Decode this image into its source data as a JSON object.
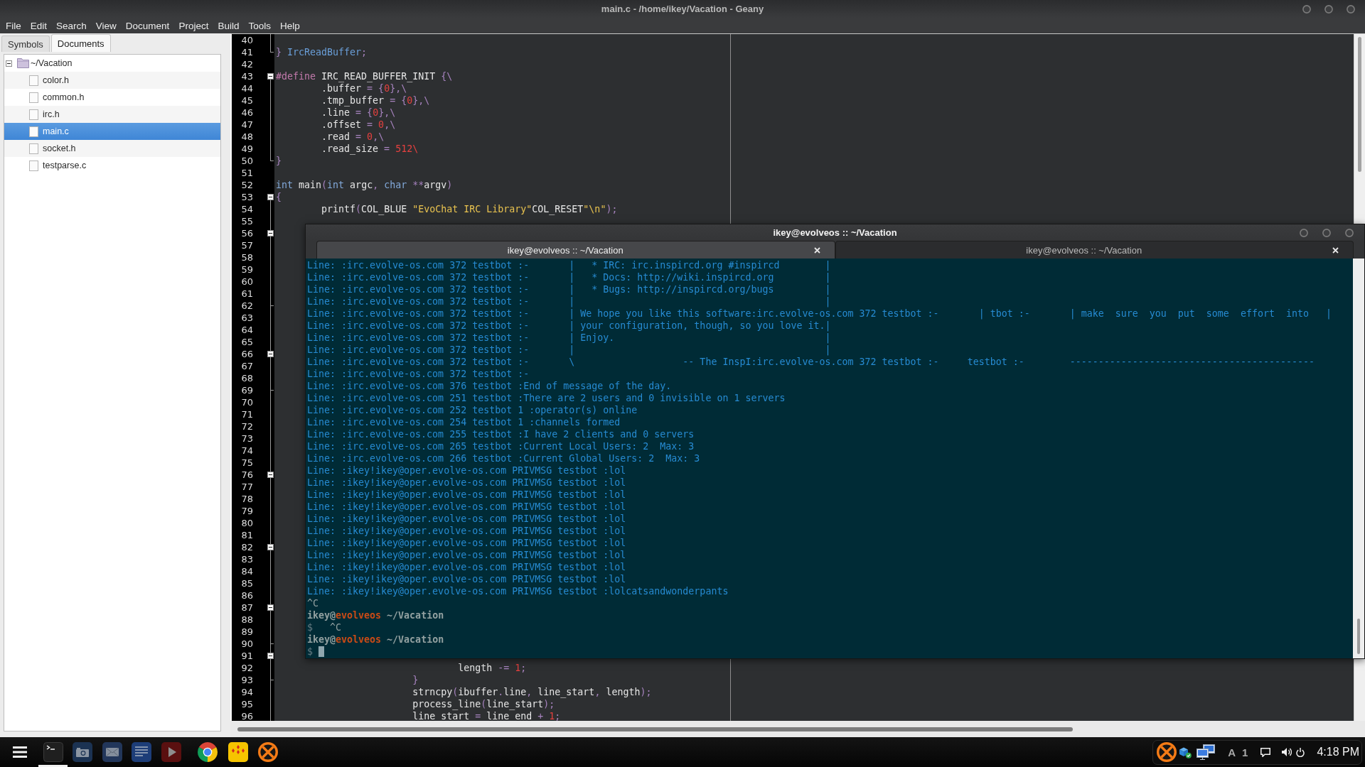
{
  "window": {
    "title": "main.c - /home/ikey/Vacation - Geany"
  },
  "menu": [
    "File",
    "Edit",
    "Search",
    "View",
    "Document",
    "Project",
    "Build",
    "Tools",
    "Help"
  ],
  "sidebar": {
    "tabs": [
      {
        "label": "Symbols",
        "selected": false
      },
      {
        "label": "Documents",
        "selected": true
      }
    ],
    "tree": [
      {
        "label": "~/Vacation",
        "expanded": true,
        "selected": false,
        "children": [
          {
            "label": "color.h",
            "selected": false
          },
          {
            "label": "common.h",
            "selected": false
          },
          {
            "label": "irc.h",
            "selected": false
          },
          {
            "label": "main.c",
            "selected": true
          },
          {
            "label": "socket.h",
            "selected": false
          },
          {
            "label": "testparse.c",
            "selected": false
          }
        ]
      }
    ]
  },
  "editor": {
    "lines": [
      {
        "number": "40",
        "kind": "body"
      },
      {
        "number": "41",
        "kind": "end",
        "tokens": [
          {
            "text": "} ",
            "kind": "operator"
          },
          {
            "text": "IrcReadBuffer",
            "kind": "type"
          },
          {
            "text": ";",
            "kind": "operator"
          }
        ]
      },
      {
        "number": "42",
        "kind": "plain"
      },
      {
        "number": "43",
        "kind": "start",
        "tokens": [
          {
            "text": "#define",
            "kind": "preprocessor"
          },
          {
            "text": " IRC_READ_BUFFER_INIT ",
            "kind": "plain"
          },
          {
            "text": "{\\",
            "kind": "operator"
          }
        ]
      },
      {
        "number": "44",
        "kind": "body",
        "tokens": [
          {
            "text": "        .buffer ",
            "kind": "plain"
          },
          {
            "text": "= {",
            "kind": "operator"
          },
          {
            "text": "0",
            "kind": "number"
          },
          {
            "text": "},\\",
            "kind": "operator"
          }
        ]
      },
      {
        "number": "45",
        "kind": "body",
        "tokens": [
          {
            "text": "        .tmp_buffer ",
            "kind": "plain"
          },
          {
            "text": "= {",
            "kind": "operator"
          },
          {
            "text": "0",
            "kind": "number"
          },
          {
            "text": "},\\",
            "kind": "operator"
          }
        ]
      },
      {
        "number": "46",
        "kind": "body",
        "tokens": [
          {
            "text": "        .line ",
            "kind": "plain"
          },
          {
            "text": "= {",
            "kind": "operator"
          },
          {
            "text": "0",
            "kind": "number"
          },
          {
            "text": "},\\",
            "kind": "operator"
          }
        ]
      },
      {
        "number": "47",
        "kind": "body",
        "tokens": [
          {
            "text": "        .offset ",
            "kind": "plain"
          },
          {
            "text": "= ",
            "kind": "operator"
          },
          {
            "text": "0",
            "kind": "number"
          },
          {
            "text": ",\\",
            "kind": "operator"
          }
        ]
      },
      {
        "number": "48",
        "kind": "body",
        "tokens": [
          {
            "text": "        .read ",
            "kind": "plain"
          },
          {
            "text": "= ",
            "kind": "operator"
          },
          {
            "text": "0",
            "kind": "number"
          },
          {
            "text": ",\\",
            "kind": "operator"
          }
        ]
      },
      {
        "number": "49",
        "kind": "body",
        "tokens": [
          {
            "text": "        .read_size ",
            "kind": "plain"
          },
          {
            "text": "= ",
            "kind": "operator"
          },
          {
            "text": "512\\",
            "kind": "number"
          }
        ]
      },
      {
        "number": "50",
        "kind": "end",
        "tokens": [
          {
            "text": "}",
            "kind": "operator"
          }
        ]
      },
      {
        "number": "51",
        "kind": "plain"
      },
      {
        "number": "52",
        "kind": "plain",
        "tokens": [
          {
            "text": "int",
            "kind": "keyword"
          },
          {
            "text": " main",
            "kind": "plain"
          },
          {
            "text": "(",
            "kind": "operator"
          },
          {
            "text": "int",
            "kind": "keyword"
          },
          {
            "text": " argc",
            "kind": "plain"
          },
          {
            "text": ", ",
            "kind": "operator"
          },
          {
            "text": "char",
            "kind": "keyword"
          },
          {
            "text": " **",
            "kind": "operator"
          },
          {
            "text": "argv",
            "kind": "plain"
          },
          {
            "text": ")",
            "kind": "operator"
          }
        ]
      },
      {
        "number": "53",
        "kind": "start",
        "tokens": [
          {
            "text": "{",
            "kind": "operator"
          }
        ]
      },
      {
        "number": "54",
        "kind": "body",
        "tokens": [
          {
            "text": "        printf",
            "kind": "plain"
          },
          {
            "text": "(",
            "kind": "operator"
          },
          {
            "text": "COL_BLUE ",
            "kind": "plain"
          },
          {
            "text": "\"EvoChat IRC Library\"",
            "kind": "string"
          },
          {
            "text": "COL_RESET",
            "kind": "plain"
          },
          {
            "text": "\"\\n\"",
            "kind": "string"
          },
          {
            "text": ");",
            "kind": "operator"
          }
        ]
      },
      {
        "number": "55",
        "kind": "body"
      },
      {
        "number": "56",
        "kind": "start"
      },
      {
        "number": "57",
        "kind": "body"
      },
      {
        "number": "58",
        "kind": "body"
      },
      {
        "number": "59",
        "kind": "body"
      },
      {
        "number": "60",
        "kind": "body"
      },
      {
        "number": "61",
        "kind": "body"
      },
      {
        "number": "62",
        "kind": "end"
      },
      {
        "number": "63",
        "kind": "body"
      },
      {
        "number": "64",
        "kind": "body"
      },
      {
        "number": "65",
        "kind": "body"
      },
      {
        "number": "66",
        "kind": "start"
      },
      {
        "number": "67",
        "kind": "body"
      },
      {
        "number": "68",
        "kind": "body"
      },
      {
        "number": "69",
        "kind": "end"
      },
      {
        "number": "70",
        "kind": "body"
      },
      {
        "number": "71",
        "kind": "body"
      },
      {
        "number": "72",
        "kind": "body"
      },
      {
        "number": "73",
        "kind": "body"
      },
      {
        "number": "74",
        "kind": "body"
      },
      {
        "number": "75",
        "kind": "body"
      },
      {
        "number": "76",
        "kind": "start"
      },
      {
        "number": "77",
        "kind": "body"
      },
      {
        "number": "78",
        "kind": "body"
      },
      {
        "number": "79",
        "kind": "body"
      },
      {
        "number": "80",
        "kind": "body"
      },
      {
        "number": "81",
        "kind": "body"
      },
      {
        "number": "82",
        "kind": "start"
      },
      {
        "number": "83",
        "kind": "body"
      },
      {
        "number": "84",
        "kind": "body"
      },
      {
        "number": "85",
        "kind": "body"
      },
      {
        "number": "86",
        "kind": "body"
      },
      {
        "number": "87",
        "kind": "start"
      },
      {
        "number": "88",
        "kind": "body"
      },
      {
        "number": "89",
        "kind": "body"
      },
      {
        "number": "90",
        "kind": "end"
      },
      {
        "number": "91",
        "kind": "start"
      },
      {
        "number": "92",
        "kind": "body",
        "tokens": [
          {
            "text": "                                length ",
            "kind": "plain"
          },
          {
            "text": "-= ",
            "kind": "operator"
          },
          {
            "text": "1",
            "kind": "number"
          },
          {
            "text": ";",
            "kind": "operator"
          }
        ]
      },
      {
        "number": "93",
        "kind": "end",
        "tokens": [
          {
            "text": "                        }",
            "kind": "operator"
          }
        ]
      },
      {
        "number": "94",
        "kind": "body",
        "tokens": [
          {
            "text": "                        strncpy",
            "kind": "plain"
          },
          {
            "text": "(",
            "kind": "operator"
          },
          {
            "text": "ibuffer",
            "kind": "plain"
          },
          {
            "text": ".",
            "kind": "operator"
          },
          {
            "text": "line",
            "kind": "plain"
          },
          {
            "text": ", ",
            "kind": "operator"
          },
          {
            "text": "line_start",
            "kind": "plain"
          },
          {
            "text": ", ",
            "kind": "operator"
          },
          {
            "text": "length",
            "kind": "plain"
          },
          {
            "text": ");",
            "kind": "operator"
          }
        ]
      },
      {
        "number": "95",
        "kind": "body",
        "tokens": [
          {
            "text": "                        process_line",
            "kind": "plain"
          },
          {
            "text": "(",
            "kind": "operator"
          },
          {
            "text": "line_start",
            "kind": "plain"
          },
          {
            "text": ");",
            "kind": "operator"
          }
        ]
      },
      {
        "number": "96",
        "kind": "body",
        "tokens": [
          {
            "text": "                        line_start ",
            "kind": "plain"
          },
          {
            "text": "= ",
            "kind": "operator"
          },
          {
            "text": "line_end ",
            "kind": "plain"
          },
          {
            "text": "+ ",
            "kind": "operator"
          },
          {
            "text": "1",
            "kind": "number"
          },
          {
            "text": ";",
            "kind": "operator"
          }
        ]
      }
    ]
  },
  "terminal": {
    "title": "ikey@evolveos :: ~/Vacation",
    "tabs": [
      {
        "label": "ikey@evolveos :: ~/Vacation",
        "selected": true
      },
      {
        "label": "ikey@evolveos :: ~/Vacation",
        "selected": false
      }
    ],
    "lines": [
      {
        "kind": "output",
        "text": "Line: :irc.evolve-os.com 372 testbot :-       |   * IRC: irc.inspircd.org #inspircd        |"
      },
      {
        "kind": "output",
        "text": "Line: :irc.evolve-os.com 372 testbot :-       |   * Docs: http://wiki.inspircd.org         |"
      },
      {
        "kind": "output",
        "text": "Line: :irc.evolve-os.com 372 testbot :-       |   * Bugs: http://inspircd.org/bugs         |"
      },
      {
        "kind": "output",
        "text": "Line: :irc.evolve-os.com 372 testbot :-       |                                            |"
      },
      {
        "kind": "output",
        "text": "Line: :irc.evolve-os.com 372 testbot :-       | We hope you like this software:irc.evolve-os.com 372 testbot :-       | tbot :-       | make  sure  you  put  some  effort  into   |"
      },
      {
        "kind": "output",
        "text": "Line: :irc.evolve-os.com 372 testbot :-       | your configuration, though, so you love it.|"
      },
      {
        "kind": "output",
        "text": "Line: :irc.evolve-os.com 372 testbot :-       | Enjoy.                                     |"
      },
      {
        "kind": "output",
        "text": "Line: :irc.evolve-os.com 372 testbot :-       |                                            |"
      },
      {
        "kind": "output",
        "text": "Line: :irc.evolve-os.com 372 testbot :-       \\                   -- The InspI:irc.evolve-os.com 372 testbot :-     testbot :-        -------------------------------------------"
      },
      {
        "kind": "output",
        "text": "Line: :irc.evolve-os.com 372 testbot :-"
      },
      {
        "kind": "output",
        "text": "Line: :irc.evolve-os.com 376 testbot :End of message of the day."
      },
      {
        "kind": "output",
        "text": "Line: :irc.evolve-os.com 251 testbot :There are 2 users and 0 invisible on 1 servers"
      },
      {
        "kind": "output",
        "text": "Line: :irc.evolve-os.com 252 testbot 1 :operator(s) online"
      },
      {
        "kind": "output",
        "text": "Line: :irc.evolve-os.com 254 testbot 1 :channels formed"
      },
      {
        "kind": "output",
        "text": "Line: :irc.evolve-os.com 255 testbot :I have 2 clients and 0 servers"
      },
      {
        "kind": "output",
        "text": "Line: :irc.evolve-os.com 265 testbot :Current Local Users: 2  Max: 3"
      },
      {
        "kind": "output",
        "text": "Line: :irc.evolve-os.com 266 testbot :Current Global Users: 2  Max: 3"
      },
      {
        "kind": "output",
        "text": "Line: :ikey!ikey@oper.evolve-os.com PRIVMSG testbot :lol"
      },
      {
        "kind": "output",
        "text": "Line: :ikey!ikey@oper.evolve-os.com PRIVMSG testbot :lol"
      },
      {
        "kind": "output",
        "text": "Line: :ikey!ikey@oper.evolve-os.com PRIVMSG testbot :lol"
      },
      {
        "kind": "output",
        "text": "Line: :ikey!ikey@oper.evolve-os.com PRIVMSG testbot :lol"
      },
      {
        "kind": "output",
        "text": "Line: :ikey!ikey@oper.evolve-os.com PRIVMSG testbot :lol"
      },
      {
        "kind": "output",
        "text": "Line: :ikey!ikey@oper.evolve-os.com PRIVMSG testbot :lol"
      },
      {
        "kind": "output",
        "text": "Line: :ikey!ikey@oper.evolve-os.com PRIVMSG testbot :lol"
      },
      {
        "kind": "output",
        "text": "Line: :ikey!ikey@oper.evolve-os.com PRIVMSG testbot :lol"
      },
      {
        "kind": "output",
        "text": "Line: :ikey!ikey@oper.evolve-os.com PRIVMSG testbot :lol"
      },
      {
        "kind": "output",
        "text": "Line: :ikey!ikey@oper.evolve-os.com PRIVMSG testbot :lol"
      },
      {
        "kind": "output",
        "text": "Line: :ikey!ikey@oper.evolve-os.com PRIVMSG testbot :lolcatsandwonderpants"
      },
      {
        "kind": "echo",
        "text": "^C"
      },
      {
        "kind": "prompt",
        "user": "ikey@",
        "host": "evolveos",
        "path": "~/Vacation"
      },
      {
        "kind": "command",
        "symbol": "$",
        "text": "^C"
      },
      {
        "kind": "prompt",
        "user": "ikey@",
        "host": "evolveos",
        "path": "~/Vacation"
      },
      {
        "kind": "command",
        "symbol": "$",
        "cursor": true
      }
    ]
  },
  "taskbar": {
    "launchers": [
      {
        "running": true
      },
      {
        "running": false
      },
      {
        "running": false
      },
      {
        "running": false
      },
      {
        "running": false
      },
      {
        "running": false
      },
      {
        "running": false
      },
      {
        "running": false
      }
    ],
    "tray_labels": [
      "A",
      "1"
    ],
    "clock": "4:18 PM"
  }
}
